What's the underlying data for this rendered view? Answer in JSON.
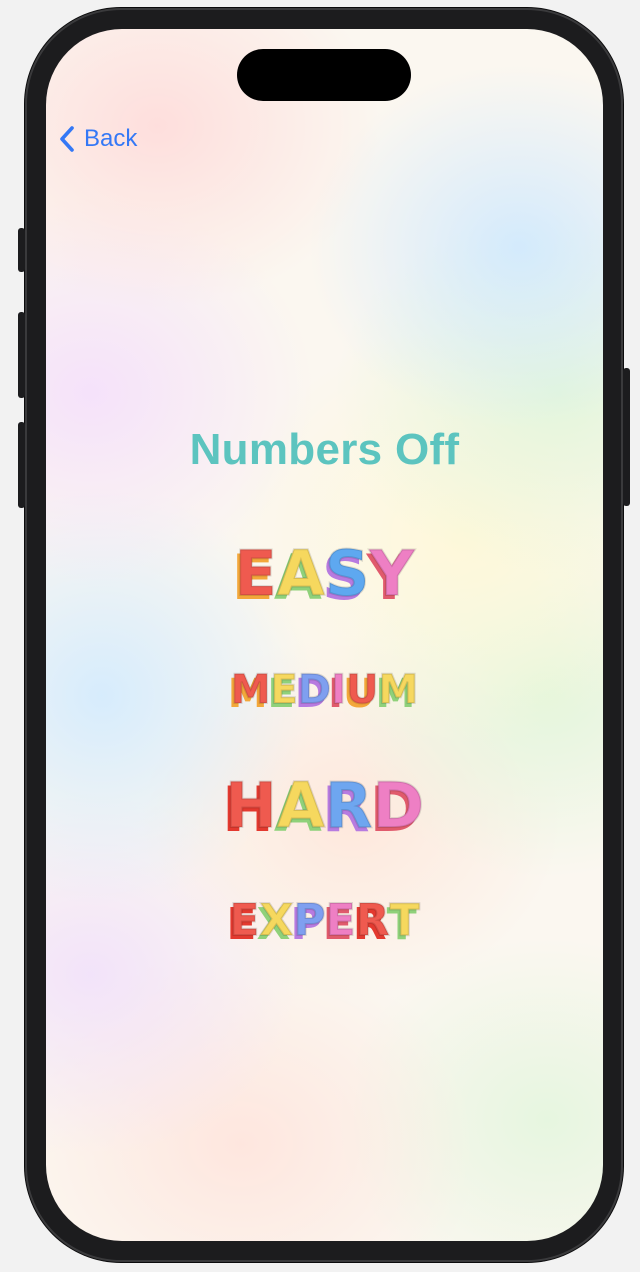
{
  "nav": {
    "back_label": "Back"
  },
  "screen": {
    "title": "Numbers Off"
  },
  "levels": [
    {
      "name": "easy",
      "letters": [
        {
          "ch": "E",
          "color": "#ef5a4f",
          "shadow": "#f3a73a"
        },
        {
          "ch": "A",
          "color": "#f6d85e",
          "shadow": "#8fd17a"
        },
        {
          "ch": "S",
          "color": "#5ea8f0",
          "shadow": "#b77be0"
        },
        {
          "ch": "Y",
          "color": "#ee7fc4",
          "shadow": "#e05a6c"
        }
      ]
    },
    {
      "name": "medium",
      "letters": [
        {
          "ch": "M",
          "color": "#ef5a4f",
          "shadow": "#f3a73a"
        },
        {
          "ch": "E",
          "color": "#f6d85e",
          "shadow": "#8fd17a"
        },
        {
          "ch": "D",
          "color": "#7f9ff0",
          "shadow": "#b77be0"
        },
        {
          "ch": "I",
          "color": "#ee7fc4",
          "shadow": "#e05a6c"
        },
        {
          "ch": "U",
          "color": "#ef5a4f",
          "shadow": "#f3a73a"
        },
        {
          "ch": "M",
          "color": "#f6d85e",
          "shadow": "#8fd17a"
        }
      ]
    },
    {
      "name": "hard",
      "letters": [
        {
          "ch": "H",
          "color": "#ef5a4f",
          "shadow": "#e3392f"
        },
        {
          "ch": "A",
          "color": "#f6d85e",
          "shadow": "#8fd17a"
        },
        {
          "ch": "R",
          "color": "#6ea6f0",
          "shadow": "#b77be0"
        },
        {
          "ch": "D",
          "color": "#ee7fc4",
          "shadow": "#e05a6c"
        }
      ]
    },
    {
      "name": "expert",
      "letters": [
        {
          "ch": "E",
          "color": "#ef5a4f",
          "shadow": "#e3392f"
        },
        {
          "ch": "X",
          "color": "#f6d85e",
          "shadow": "#8fd17a"
        },
        {
          "ch": "P",
          "color": "#7f9ff0",
          "shadow": "#b77be0"
        },
        {
          "ch": "E",
          "color": "#ee7fc4",
          "shadow": "#e05a6c"
        },
        {
          "ch": "R",
          "color": "#ef5a4f",
          "shadow": "#e3392f"
        },
        {
          "ch": "T",
          "color": "#f6d85e",
          "shadow": "#8fd17a"
        }
      ]
    }
  ],
  "icons": {
    "back": "chevron-left-icon"
  },
  "colors": {
    "accent": "#3478f6",
    "title": "#5cc4bf"
  }
}
